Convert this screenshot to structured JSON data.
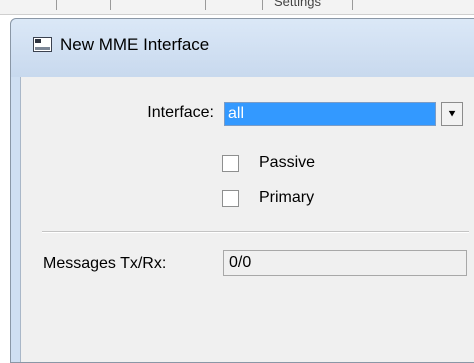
{
  "background_window": {
    "partial_text": "Settings"
  },
  "dialog": {
    "title": "New MME Interface",
    "icon": "window-icon",
    "fields": {
      "interface": {
        "label": "Interface:",
        "value": "all"
      },
      "passive": {
        "label": "Passive",
        "checked": false
      },
      "primary": {
        "label": "Primary",
        "checked": false
      },
      "messages": {
        "label": "Messages Tx/Rx:",
        "value": "0/0"
      }
    }
  },
  "colors": {
    "titlebar": "#c8d9ee",
    "selection": "#3399ff",
    "client_bg": "#f0f0f0"
  }
}
